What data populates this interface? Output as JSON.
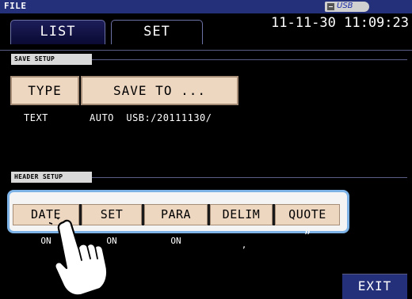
{
  "window": {
    "title": "FILE"
  },
  "usb": {
    "label": "USB",
    "icon": "usb-drive-icon"
  },
  "tabs": [
    {
      "label": "LIST",
      "selected": true
    },
    {
      "label": "SET",
      "selected": false
    }
  ],
  "clock": "11-11-30 11:09:23",
  "save_setup": {
    "section_label": "SAVE SETUP",
    "type_button": "TYPE",
    "save_to_button": "SAVE TO ...",
    "type_value": "TEXT",
    "save_to_value": "AUTO  USB:/20111130/"
  },
  "header_setup": {
    "section_label": "HEADER SETUP",
    "buttons": [
      {
        "label": "DATE",
        "value": "ON"
      },
      {
        "label": "SET",
        "value": "ON"
      },
      {
        "label": "PARA",
        "value": "ON"
      },
      {
        "label": "DELIM",
        "value": ","
      },
      {
        "label": "QUOTE",
        "value": "”"
      }
    ]
  },
  "exit_button": "EXIT",
  "colors": {
    "title_bar": "#25307a",
    "button_face": "#eed7c1",
    "highlight_border": "#7db3e6",
    "section_label_bg": "#d9d9d9"
  },
  "pointer_icon": "pointing-hand-icon"
}
